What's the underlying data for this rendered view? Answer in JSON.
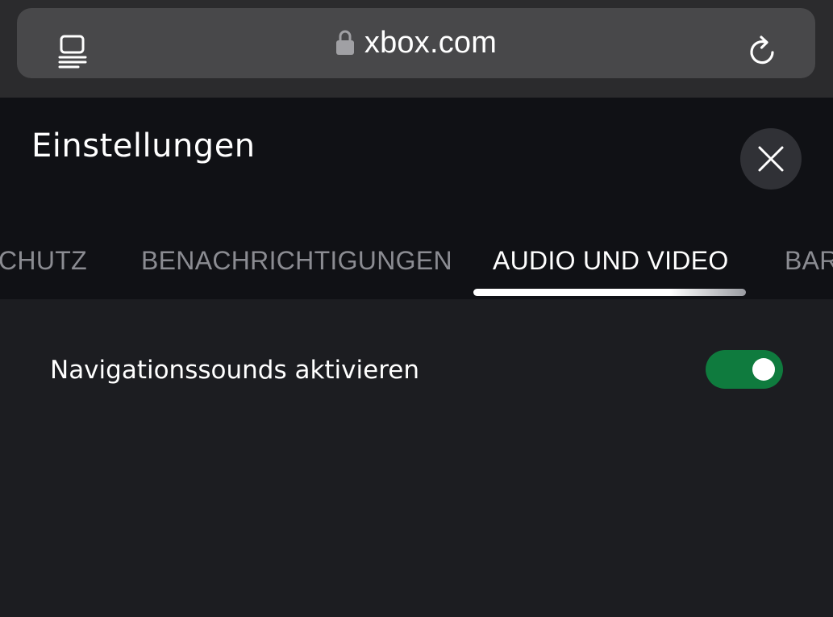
{
  "browser": {
    "url": "xbox.com",
    "icons": {
      "reader": "reader-mode-icon",
      "lock": "lock-icon",
      "reload": "reload-icon"
    }
  },
  "settings": {
    "title": "Einstellungen",
    "close_icon": "close-icon",
    "tabs": [
      {
        "label": "DATENSCHUTZ",
        "visible_text": "CHUTZ",
        "active": false
      },
      {
        "label": "BENACHRICHTIGUNGEN",
        "visible_text": "BENACHRICHTIGUNGEN",
        "active": false
      },
      {
        "label": "AUDIO UND VIDEO",
        "visible_text": "AUDIO UND VIDEO",
        "active": true
      },
      {
        "label": "BARRIEREFREIHEIT",
        "visible_text": "BAR",
        "active": false
      }
    ],
    "options": [
      {
        "label": "Navigationssounds aktivieren",
        "enabled": true
      }
    ]
  },
  "colors": {
    "toggle_on": "#0f7b3e",
    "header_bg": "#101115",
    "content_bg": "#1c1d21",
    "url_bar_bg": "#48484a"
  }
}
